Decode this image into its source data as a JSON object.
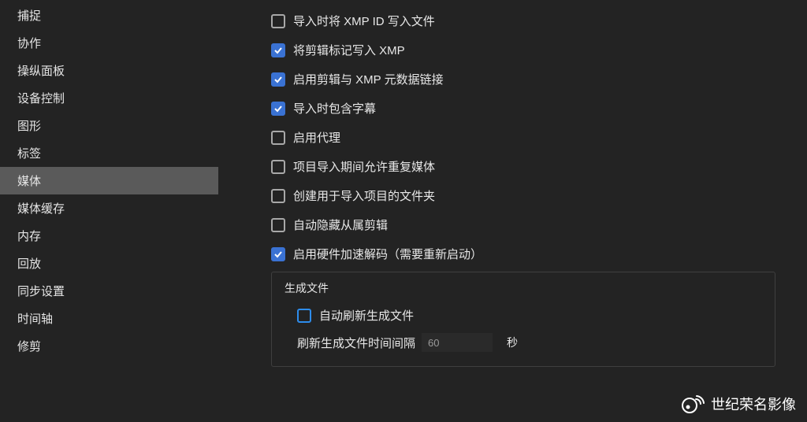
{
  "sidebar": {
    "items": [
      {
        "label": "捕捉",
        "selected": false
      },
      {
        "label": "协作",
        "selected": false
      },
      {
        "label": "操纵面板",
        "selected": false
      },
      {
        "label": "设备控制",
        "selected": false
      },
      {
        "label": "图形",
        "selected": false
      },
      {
        "label": "标签",
        "selected": false
      },
      {
        "label": "媒体",
        "selected": true
      },
      {
        "label": "媒体缓存",
        "selected": false
      },
      {
        "label": "内存",
        "selected": false
      },
      {
        "label": "回放",
        "selected": false
      },
      {
        "label": "同步设置",
        "selected": false
      },
      {
        "label": "时间轴",
        "selected": false
      },
      {
        "label": "修剪",
        "selected": false
      }
    ]
  },
  "options": [
    {
      "label": "导入时将 XMP ID 写入文件",
      "checked": false
    },
    {
      "label": "将剪辑标记写入 XMP",
      "checked": true
    },
    {
      "label": "启用剪辑与 XMP 元数据链接",
      "checked": true
    },
    {
      "label": "导入时包含字幕",
      "checked": true
    },
    {
      "label": "启用代理",
      "checked": false
    },
    {
      "label": "项目导入期间允许重复媒体",
      "checked": false
    },
    {
      "label": "创建用于导入项目的文件夹",
      "checked": false
    },
    {
      "label": "自动隐藏从属剪辑",
      "checked": false
    },
    {
      "label": "启用硬件加速解码（需要重新启动）",
      "checked": true
    }
  ],
  "group": {
    "title": "生成文件",
    "auto_refresh": {
      "label": "自动刷新生成文件",
      "checked": false,
      "highlighted": true
    },
    "interval_label": "刷新生成文件时间间隔",
    "interval_value": "60",
    "interval_unit": "秒"
  },
  "watermark": "世纪荣名影像"
}
